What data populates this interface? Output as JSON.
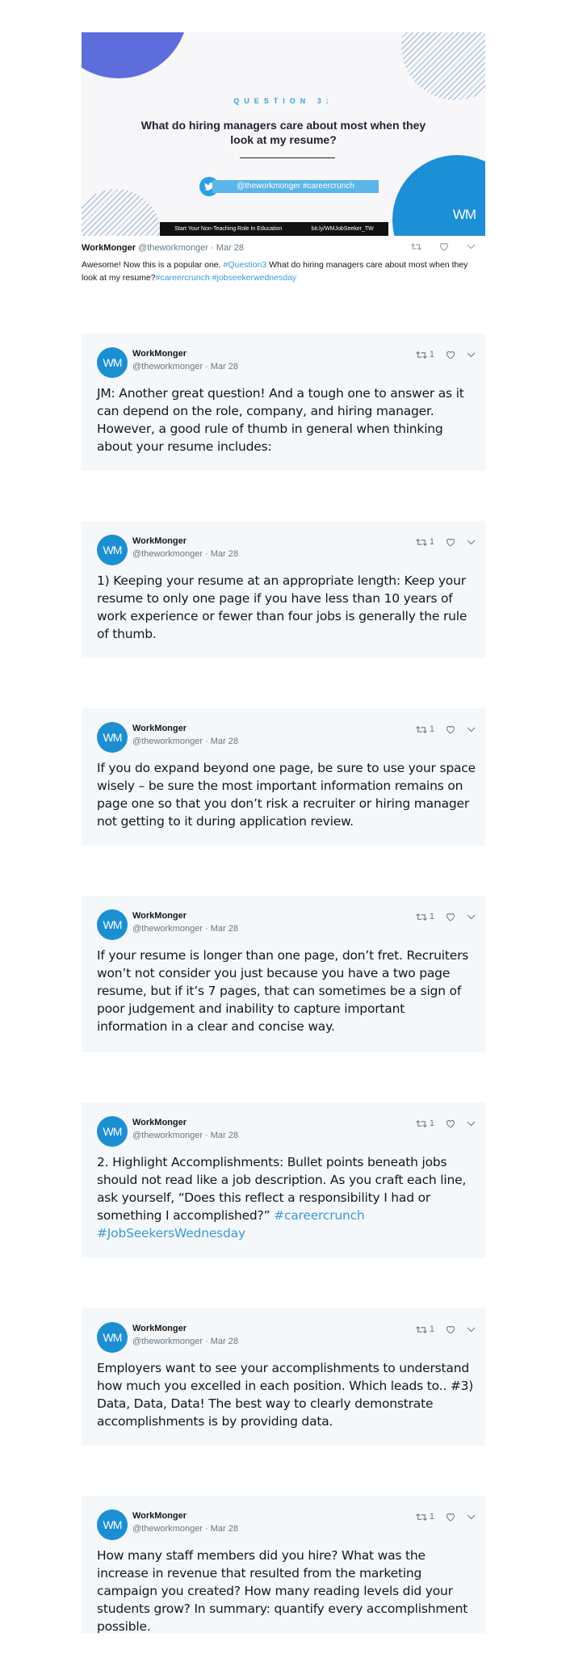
{
  "graphic": {
    "question_label": "QUESTION 3:",
    "question_title": "What do hiring managers care about most when they look at my resume?",
    "handle_pill": "@theworkmonger #careercrunch",
    "footer_left": "Start Your Non-Teaching Role In Education",
    "footer_right": "bit.ly/WMJobSeeker_TW",
    "logo": "WM"
  },
  "first_tweet": {
    "name": "WorkMonger",
    "handle": "@theworkmonger",
    "date": "· Mar 28",
    "text_1": "Awesome! Now this is a popular one. ",
    "link_1": "#Question3",
    "text_2": " What do hiring managers care about most when they look at my resume?",
    "link_2": "#careercrunch",
    "link_3": "#jobseekerwednesday"
  },
  "author": {
    "name": "WorkMonger",
    "handle_date": "@theworkmonger · Mar 28",
    "avatar_text": "WM",
    "retweet_count": "1"
  },
  "tweets": [
    {
      "text": "JM: Another great question! And a tough one to answer as it can depend on the role, company, and hiring manager. However, a good rule of thumb in general when thinking about your resume includes:"
    },
    {
      "text": "1) Keeping your resume at an appropriate length: Keep your resume to only one page if you have less than 10 years of work experience or fewer than four jobs is generally the rule of thumb."
    },
    {
      "text": "If you do expand beyond one page, be sure to use your space wisely – be sure the most important information remains on page one so that you don’t risk a recruiter or hiring manager not getting to it during application review."
    },
    {
      "text": "If your resume is longer than one page, don’t fret. Recruiters won’t not consider you just because you have a two page resume, but if it’s 7 pages, that can sometimes be a sign of poor judgement and inability to capture important information in a clear and concise way."
    },
    {
      "text": "2. Highlight Accomplishments: Bullet points beneath jobs should not read like a job description. As you craft each line, ask yourself, “Does this reflect a responsibility I had or something I accomplished?” ",
      "link_a": "#careercrunch",
      "link_b": "#JobSeekersWednesday"
    },
    {
      "text": "Employers want to see your accomplishments to understand how much you excelled in each position. Which leads to.. #3) Data, Data, Data! The best way to clearly demonstrate accomplishments is by providing data."
    },
    {
      "text": "How many staff members did you hire? What was the increase in revenue that resulted from the marketing campaign you created? How many reading levels did your students grow? In summary: quantify every accomplishment possible."
    }
  ],
  "colors": {
    "link": "#3a9ad9",
    "card_bg": "#f5f8fa",
    "avatar": "#1c8fd2"
  }
}
